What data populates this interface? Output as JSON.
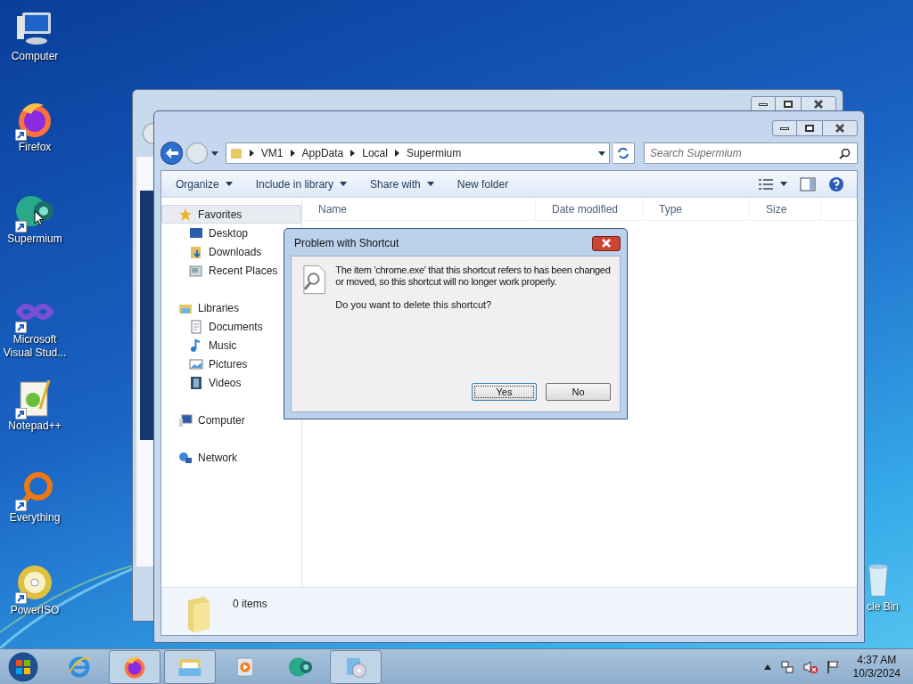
{
  "desktop_icons": [
    {
      "label": "Computer",
      "kind": "computer",
      "shortcut": false
    },
    {
      "label": "Firefox",
      "kind": "firefox",
      "shortcut": true
    },
    {
      "label": "Supermium",
      "kind": "supermium",
      "shortcut": true
    },
    {
      "label": "Microsoft Visual Stud...",
      "kind": "vs",
      "shortcut": true
    },
    {
      "label": "Notepad++",
      "kind": "notepad",
      "shortcut": true
    },
    {
      "label": "Everything",
      "kind": "everything",
      "shortcut": true
    },
    {
      "label": "PowerISO",
      "kind": "disc",
      "shortcut": true
    }
  ],
  "recycle_bin": {
    "label": "cle Bin"
  },
  "explorer": {
    "address": [
      "VM1",
      "AppData",
      "Local",
      "Supermium"
    ],
    "search": {
      "placeholder": "Search Supermium"
    },
    "toolbar": [
      {
        "label": "Organize",
        "dropdown": true
      },
      {
        "label": "Include in library",
        "dropdown": true
      },
      {
        "label": "Share with",
        "dropdown": true
      },
      {
        "label": "New folder",
        "dropdown": false
      }
    ],
    "nav": [
      {
        "label": "Favorites",
        "kind": "star",
        "selected": true,
        "children": [
          {
            "label": "Desktop",
            "kind": "desktop",
            "selected": false
          },
          {
            "label": "Downloads",
            "kind": "downloads",
            "selected": false
          },
          {
            "label": "Recent Places",
            "kind": "recent",
            "selected": false
          }
        ]
      },
      {
        "label": "Libraries",
        "kind": "library",
        "selected": false,
        "children": [
          {
            "label": "Documents",
            "kind": "documents",
            "selected": false
          },
          {
            "label": "Music",
            "kind": "music",
            "selected": false
          },
          {
            "label": "Pictures",
            "kind": "pictures",
            "selected": false
          },
          {
            "label": "Videos",
            "kind": "videos",
            "selected": false
          }
        ]
      },
      {
        "label": "Computer",
        "kind": "computer",
        "selected": false
      },
      {
        "label": "Network",
        "kind": "network",
        "selected": false
      }
    ],
    "columns": [
      "Name",
      "Date modified",
      "Type",
      "Size"
    ],
    "status": "0 items"
  },
  "dialog": {
    "title": "Problem with Shortcut",
    "message": "The item 'chrome.exe' that this shortcut refers to has been changed or moved, so this shortcut will no longer work properly.",
    "question": "Do you want to delete this shortcut?",
    "buttons": [
      {
        "label": "Yes",
        "focused": true
      },
      {
        "label": "No",
        "focused": false
      }
    ]
  },
  "taskbar": {
    "items": [
      {
        "kind": "ie",
        "running": false
      },
      {
        "kind": "firefox",
        "running": true
      },
      {
        "kind": "folder",
        "running": true
      },
      {
        "kind": "media",
        "running": false
      },
      {
        "kind": "supermium",
        "running": false
      },
      {
        "kind": "burner",
        "running": true
      }
    ],
    "time": "4:37 AM",
    "date": "10/3/2024"
  }
}
